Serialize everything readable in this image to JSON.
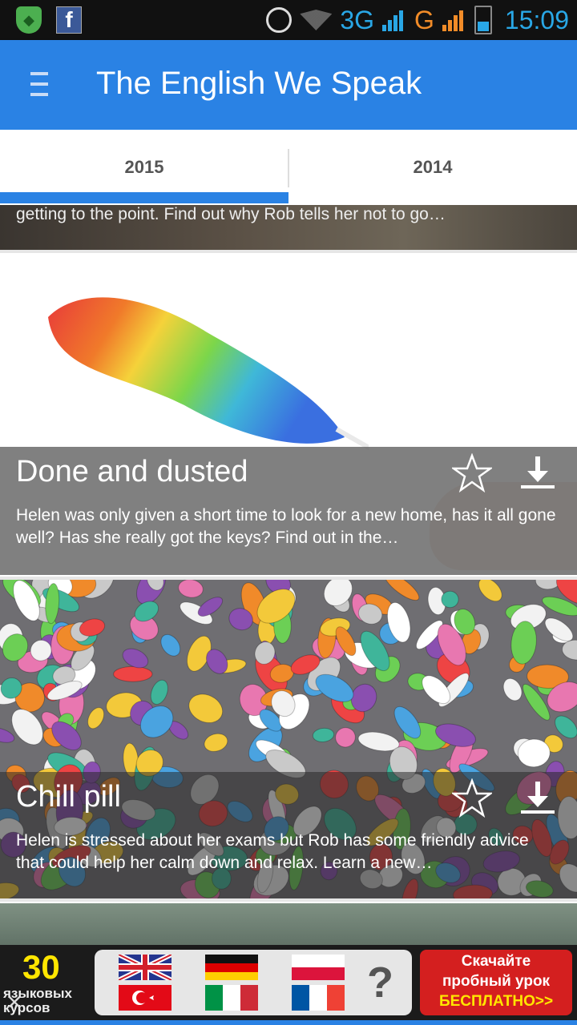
{
  "status_bar": {
    "network_1": "3G",
    "network_2": "G",
    "time": "15:09"
  },
  "app_bar": {
    "title": "The English We Speak"
  },
  "tabs": [
    {
      "label": "2015",
      "selected": true
    },
    {
      "label": "2014",
      "selected": false
    }
  ],
  "episodes": [
    {
      "snippet": "getting to the point. Find out why Rob tells her not to go…"
    },
    {
      "title": "Done and dusted",
      "description": "Helen was only given a short time to look for a new home, has it all gone well? Has she really got the keys? Find out in the…"
    },
    {
      "title": "Chill pill",
      "description": "Helen is stressed about her exams but Rob has some friendly advice that could help her calm down and relax. Learn a new…"
    }
  ],
  "ad": {
    "count": "30",
    "subtitle_1": "языковых",
    "subtitle_2": "курсов",
    "question": "?",
    "cta_line1": "Скачайте",
    "cta_line2": "пробный урок",
    "cta_line3": "БЕСПЛАТНО>>"
  },
  "colors": {
    "primary": "#2a82e4",
    "status_accent": "#29a7e6",
    "ad_cta": "#d41f1f"
  }
}
